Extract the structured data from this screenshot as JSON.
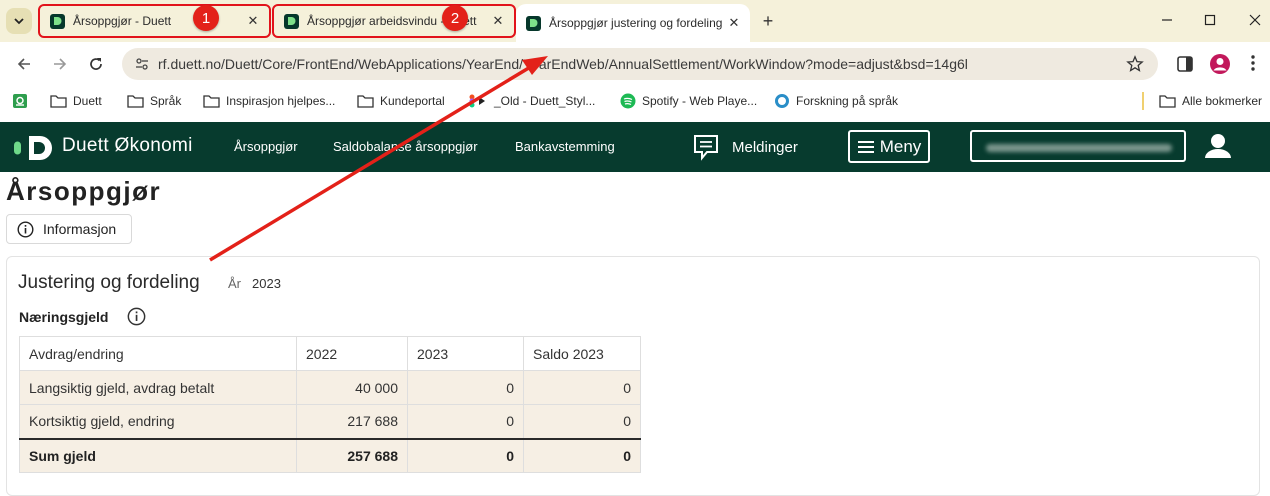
{
  "browser": {
    "tabs": [
      {
        "title": "Årsoppgjør - Duett",
        "badge": "1"
      },
      {
        "title": "Årsoppgjør arbeidsvindu - Duett",
        "badge": "2"
      },
      {
        "title": "Årsoppgjør justering og fordeling - Duett"
      }
    ],
    "url": "rf.duett.no/Duett/Core/FrontEnd/WebApplications/YearEnd/YearEndWeb/AnnualSettlement/WorkWindow?mode=adjust&bsd=14g6l",
    "bookmarks": [
      {
        "label": "",
        "icon": "green-square-icon"
      },
      {
        "label": "Duett",
        "icon": "folder-icon"
      },
      {
        "label": "Språk",
        "icon": "folder-icon"
      },
      {
        "label": "Inspirasjon hjelpes...",
        "icon": "folder-icon"
      },
      {
        "label": "Kundeportal",
        "icon": "folder-icon"
      },
      {
        "label": "_Old - Duett_Styl...",
        "icon": "figma-icon"
      },
      {
        "label": "Spotify - Web Playe...",
        "icon": "spotify-icon"
      },
      {
        "label": "Forskning på språk",
        "icon": "blue-ring-icon"
      }
    ],
    "all_bookmarks": "Alle bokmerker"
  },
  "app": {
    "brand": "Duett Økonomi",
    "nav": [
      "Årsoppgjør",
      "Saldobalanse årsoppgjør",
      "Bankavstemming"
    ],
    "messages": "Meldinger",
    "menu": "Meny"
  },
  "page": {
    "title": "Årsoppgjør",
    "info_button": "Informasjon",
    "section_title": "Justering og fordeling",
    "year_label": "År",
    "year_value": "2023",
    "subsection": "Næringsgjeld"
  },
  "table": {
    "headers": [
      "Avdrag/endring",
      "2022",
      "2023",
      "Saldo 2023"
    ],
    "rows": [
      [
        "Langsiktig gjeld, avdrag betalt",
        "40 000",
        "0",
        "0"
      ],
      [
        "Kortsiktig gjeld, endring",
        "217 688",
        "0",
        "0"
      ]
    ],
    "sum": [
      "Sum gjeld",
      "257 688",
      "0",
      "0"
    ]
  },
  "colors": {
    "app_header": "#073b2e",
    "tab_strip": "#f5f1da",
    "table_row": "#f6efe4",
    "annotation_red": "#e32119"
  }
}
